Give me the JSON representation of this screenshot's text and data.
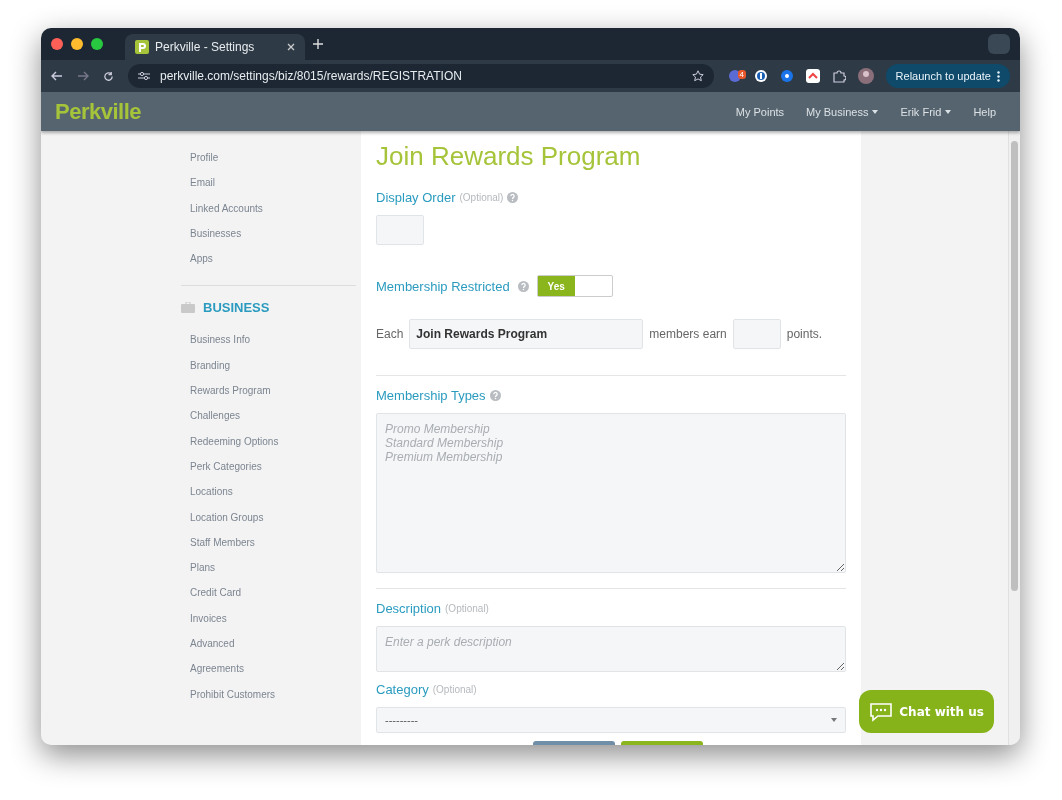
{
  "browser": {
    "tab_title": "Perkville - Settings",
    "url": "perkville.com/settings/biz/8015/rewards/REGISTRATION",
    "extension_badge": "4",
    "relaunch_button": "Relaunch to update"
  },
  "navbar": {
    "logo": "Perkville",
    "items": [
      {
        "label": "My Points",
        "has_menu": false
      },
      {
        "label": "My Business",
        "has_menu": true
      },
      {
        "label": "Erik Frid",
        "has_menu": true
      },
      {
        "label": "Help",
        "has_menu": false
      }
    ]
  },
  "sidebar": {
    "account_items": [
      {
        "label": "Profile",
        "selected": false
      },
      {
        "label": "Email",
        "selected": false
      },
      {
        "label": "Linked Accounts",
        "selected": false
      },
      {
        "label": "Businesses",
        "selected": false
      },
      {
        "label": "Apps",
        "selected": false
      }
    ],
    "business_header": "BUSINESS",
    "business_items": [
      {
        "label": "Business Info",
        "selected": false
      },
      {
        "label": "Branding",
        "selected": false
      },
      {
        "label": "Rewards Program",
        "selected": false
      },
      {
        "label": "Challenges",
        "selected": false
      },
      {
        "label": "Redeeming Options",
        "selected": false
      },
      {
        "label": "Perk Categories",
        "selected": false
      },
      {
        "label": "Locations",
        "selected": false
      },
      {
        "label": "Location Groups",
        "selected": false
      },
      {
        "label": "Staff Members",
        "selected": false
      },
      {
        "label": "Plans",
        "selected": false
      },
      {
        "label": "Credit Card",
        "selected": false
      },
      {
        "label": "Invoices",
        "selected": false
      },
      {
        "label": "Advanced",
        "selected": false
      },
      {
        "label": "Agreements",
        "selected": false
      },
      {
        "label": "Prohibit Customers",
        "selected": false
      }
    ]
  },
  "form": {
    "title": "Join Rewards Program",
    "display_order": {
      "label": "Display Order",
      "optional": "(Optional)"
    },
    "membership_restricted": {
      "label": "Membership Restricted",
      "on": true,
      "on_label": "Yes"
    },
    "earn_row": {
      "prefix": "Each",
      "name_value": "Join Rewards Program",
      "middle": "members earn",
      "suffix": "points."
    },
    "membership_types": {
      "label": "Membership Types",
      "placeholder": "Promo Membership\nStandard Membership\nPremium Membership"
    },
    "description": {
      "label": "Description",
      "optional": "(Optional)",
      "placeholder": "Enter a perk description"
    },
    "category": {
      "label": "Category",
      "optional": "(Optional)",
      "value": "---------"
    }
  },
  "chat_button": "Chat with us"
}
